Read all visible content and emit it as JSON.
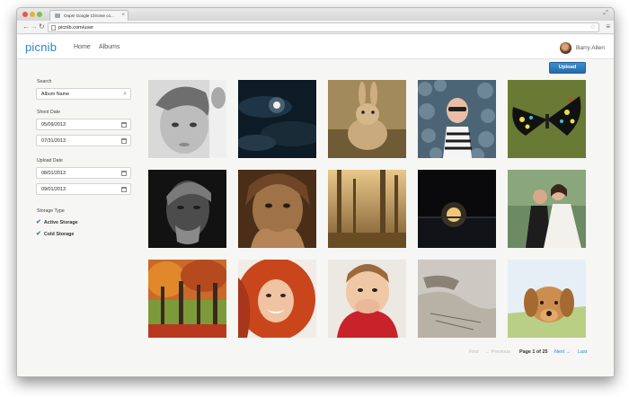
{
  "browser": {
    "tab_title": "Oops! Google Chrome co...",
    "url": "picnib.com/user"
  },
  "header": {
    "logo": "picnib",
    "nav": [
      "Home",
      "Albums"
    ],
    "user_name": "Barry Allen"
  },
  "sidebar": {
    "search_label": "Search",
    "search_value": "Album Name",
    "shoot_date_label": "Shoot Date",
    "shoot_from": "05/09/2013",
    "shoot_to": "07/31/2013",
    "upload_date_label": "Upload Date",
    "upload_from": "08/01/2013",
    "upload_to": "09/01/2013",
    "storage_label": "Storage Type",
    "storage_options": [
      "Active Storage",
      "Cold Storage"
    ]
  },
  "toolbar": {
    "upload_label": "Upload"
  },
  "photos": [
    "child-bw",
    "moon-clouds",
    "rabbit",
    "woman-stones",
    "butterfly",
    "old-man-bw",
    "old-woman-hands",
    "foggy-forest",
    "moon-lake",
    "wedding-couple",
    "autumn-trees",
    "red-hair-woman",
    "laughing-boy",
    "hand-sketch",
    "puppy"
  ],
  "pagination": {
    "first": "First",
    "previous": "← Previous",
    "page_info": "Page 1 of 25",
    "next": "Next →",
    "last": "Last"
  },
  "colors": {
    "accent": "#2b84c3",
    "upload_button": "#3079bd"
  }
}
